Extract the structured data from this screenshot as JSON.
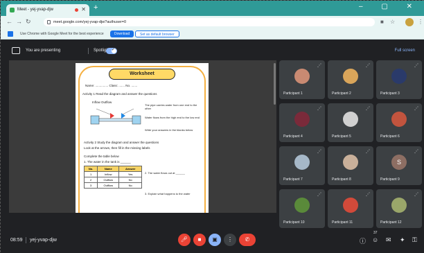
{
  "browser": {
    "tab_title": "Meet - yej-yvap-djw",
    "url": "meet.google.com/yej-yvap-djw?authuser=0",
    "bookmark_text": "Use Chrome with Google Meet for the best experience",
    "bookmark_primary": "Download",
    "bookmark_secondary": "Set as default browser"
  },
  "meet": {
    "present_label": "You are presenting",
    "pin_label": "Spotlight",
    "fullscreen_label": "Full screen",
    "time": "08:59",
    "meeting_code": "yej-yvap-djw"
  },
  "presentation": {
    "title": "Worksheet",
    "lines": [
      "Name: ...............  Class: ....... No. .......",
      "Activity 1  Read the diagram and answer the questions",
      "Inflow            Outflow",
      "The pipe carries water from one end to the other",
      "Water flows from the high end to the low end",
      "Write your answers in the blanks below",
      "Activity 2  Study the diagram and answer the questions",
      "Look at the arrows, then fill in the missing labels",
      "Complete the table below",
      "1. The water in the tank is ______",
      "2. The water flows out at ______",
      "3. Explain what happens to the water"
    ],
    "table": {
      "headers": [
        "No.",
        "Name",
        "Answer"
      ],
      "rows": [
        [
          "1",
          "Inflow",
          "Yes"
        ],
        [
          "2",
          "Outflow",
          "No"
        ],
        [
          "3",
          "Outflow",
          "No"
        ]
      ]
    }
  },
  "participants": [
    {
      "name": "Participant 1",
      "color": "#c98a72"
    },
    {
      "name": "Participant 2",
      "color": "#d9a55a"
    },
    {
      "name": "Participant 3",
      "color": "#2a3a6a"
    },
    {
      "name": "Participant 4",
      "color": "#7a2a3a"
    },
    {
      "name": "Participant 5",
      "color": "#d0d0d0"
    },
    {
      "name": "Participant 6",
      "color": "#c2543e"
    },
    {
      "name": "Participant 7",
      "color": "#a6b8c8"
    },
    {
      "name": "Participant 8",
      "color": "#c9b09a"
    },
    {
      "name": "Participant 9",
      "letter": "S",
      "color": "#8d6e63"
    },
    {
      "name": "Participant 10",
      "color": "#5a8a3a"
    },
    {
      "name": "Participant 11",
      "color": "#d24a3a"
    },
    {
      "name": "Participant 12",
      "color": "#9aa66a"
    }
  ],
  "participant_count_badge": "37"
}
